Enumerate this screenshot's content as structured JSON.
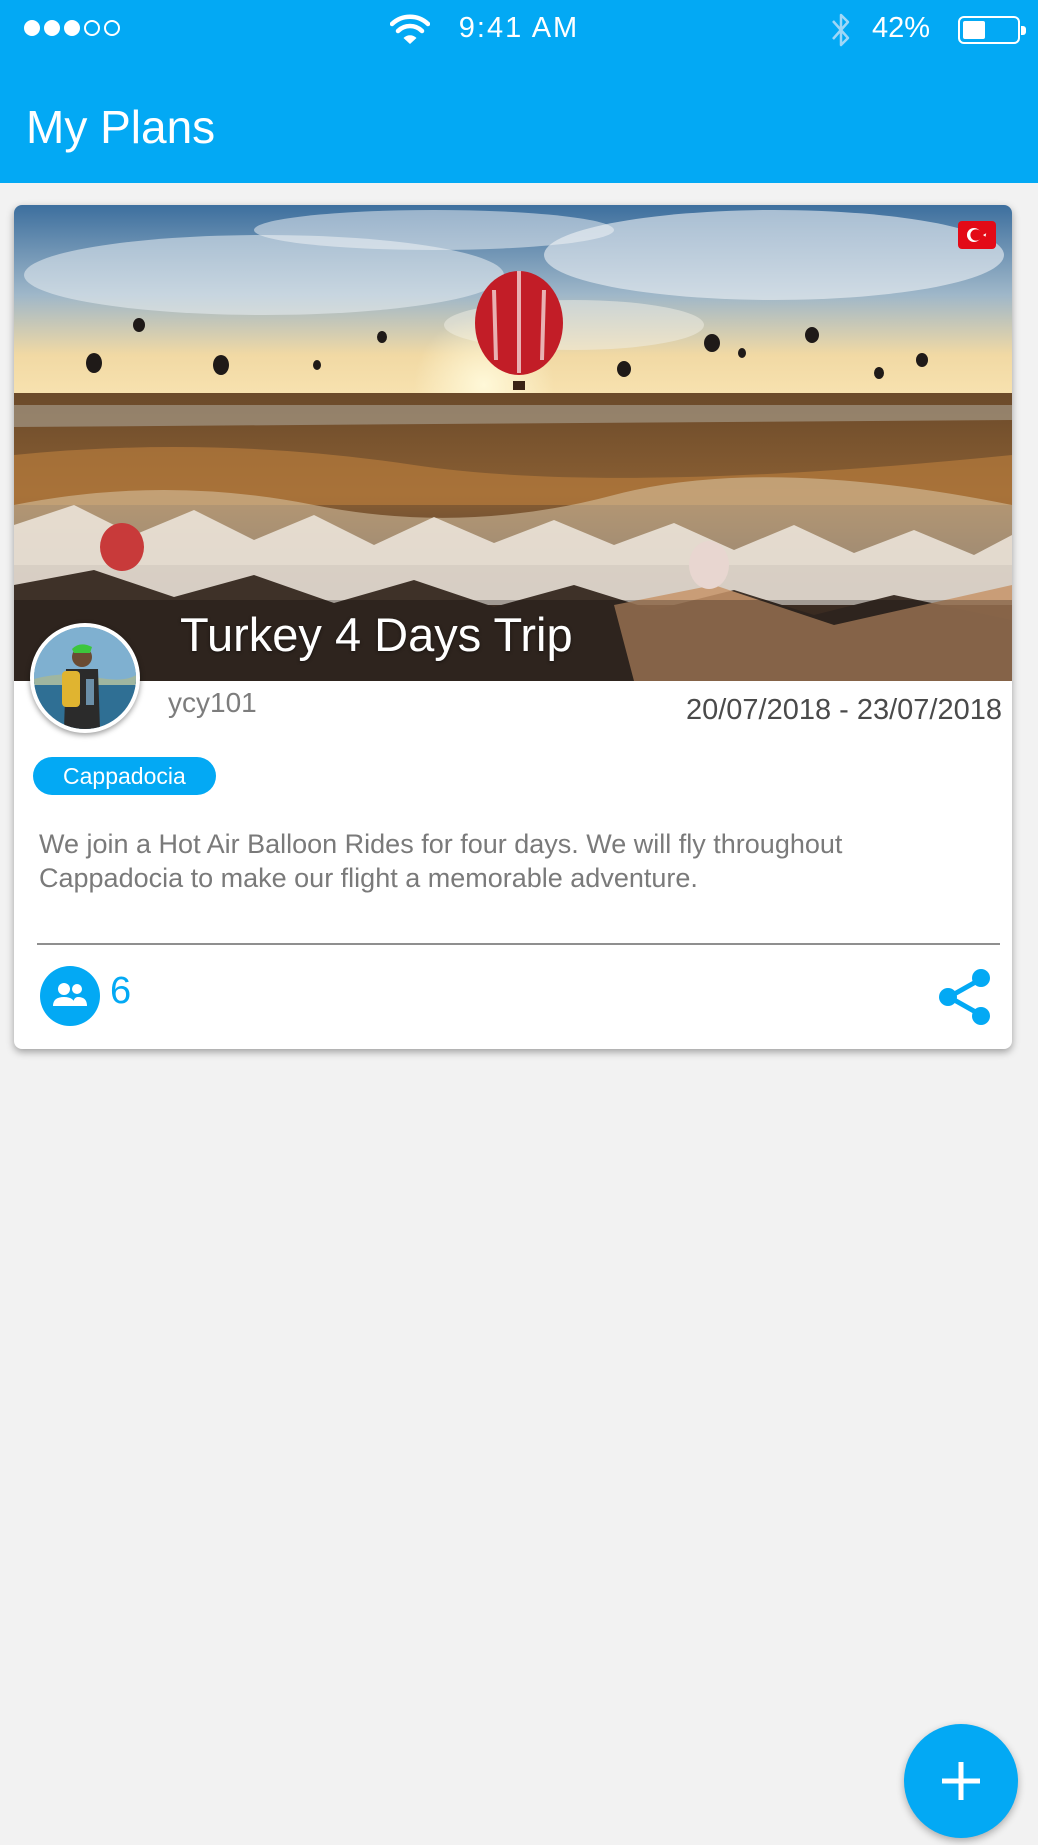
{
  "status_bar": {
    "time": "9:41 AM",
    "battery_percent": "42%",
    "battery_level": 0.42,
    "signal_bars_filled": 3,
    "signal_bars_total": 5
  },
  "header": {
    "title": "My Plans"
  },
  "plan_card": {
    "title": "Turkey 4 Days Trip",
    "username": "ycy101",
    "dates": "20/07/2018 - 23/07/2018",
    "tag": "Cappadocia",
    "description": "We join a Hot Air Balloon Rides for four days.  We will fly throughout Cappadocia to make our flight a memorable adventure.",
    "participant_count": "6",
    "country_flag": "turkey-flag"
  },
  "colors": {
    "accent": "#03a9f4",
    "background": "#f2f2f2",
    "card": "#ffffff"
  },
  "icons": {
    "add": "plus-icon",
    "share": "share-icon",
    "participants": "people-icon"
  }
}
